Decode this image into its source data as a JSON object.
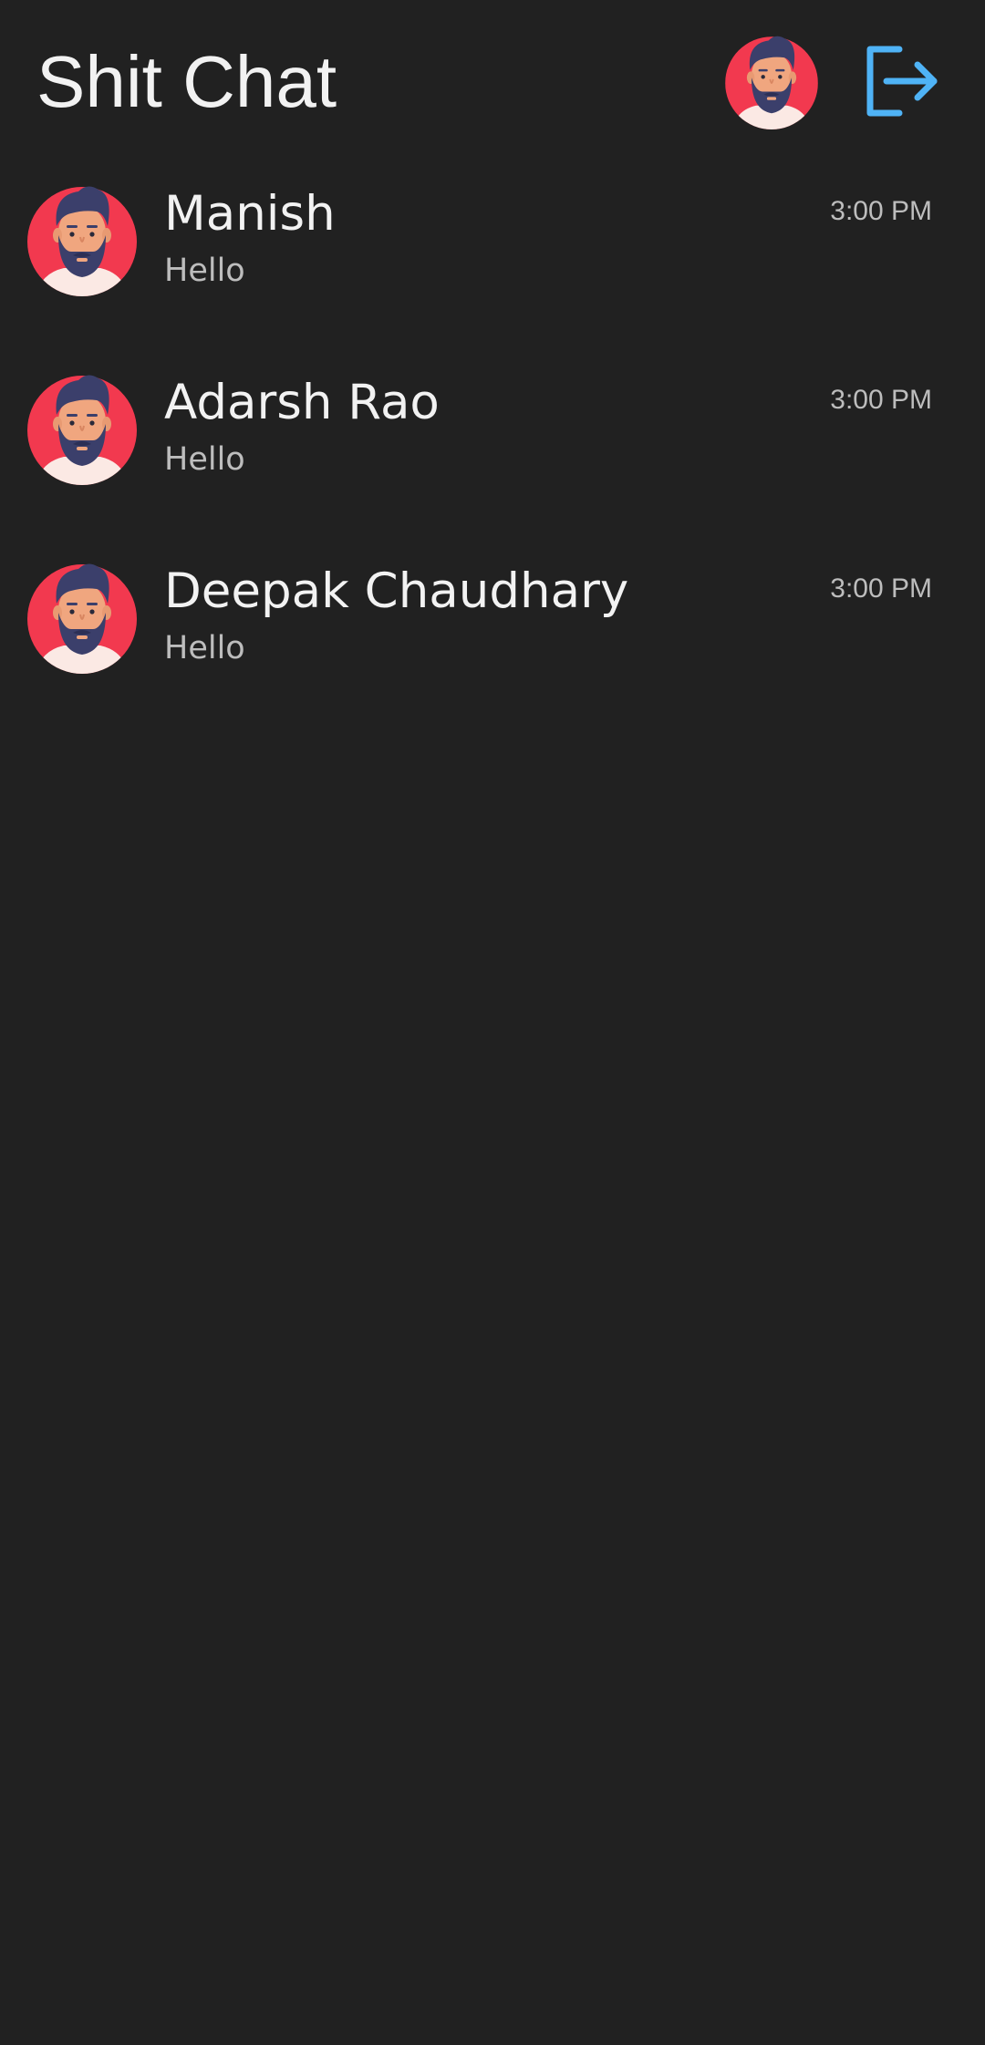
{
  "header": {
    "title": "Shit Chat",
    "avatar_icon": "user-avatar-icon",
    "logout_icon": "logout-icon"
  },
  "colors": {
    "background": "#212121",
    "text_primary": "#f2f2f2",
    "text_secondary": "#bdbdbd",
    "accent": "#4fb3f6",
    "avatar_bg": "#f2394f"
  },
  "chats": [
    {
      "name": "Manish",
      "message": "Hello",
      "time": "3:00 PM"
    },
    {
      "name": "Adarsh Rao",
      "message": "Hello",
      "time": "3:00 PM"
    },
    {
      "name": "Deepak Chaudhary",
      "message": "Hello",
      "time": "3:00 PM"
    }
  ]
}
